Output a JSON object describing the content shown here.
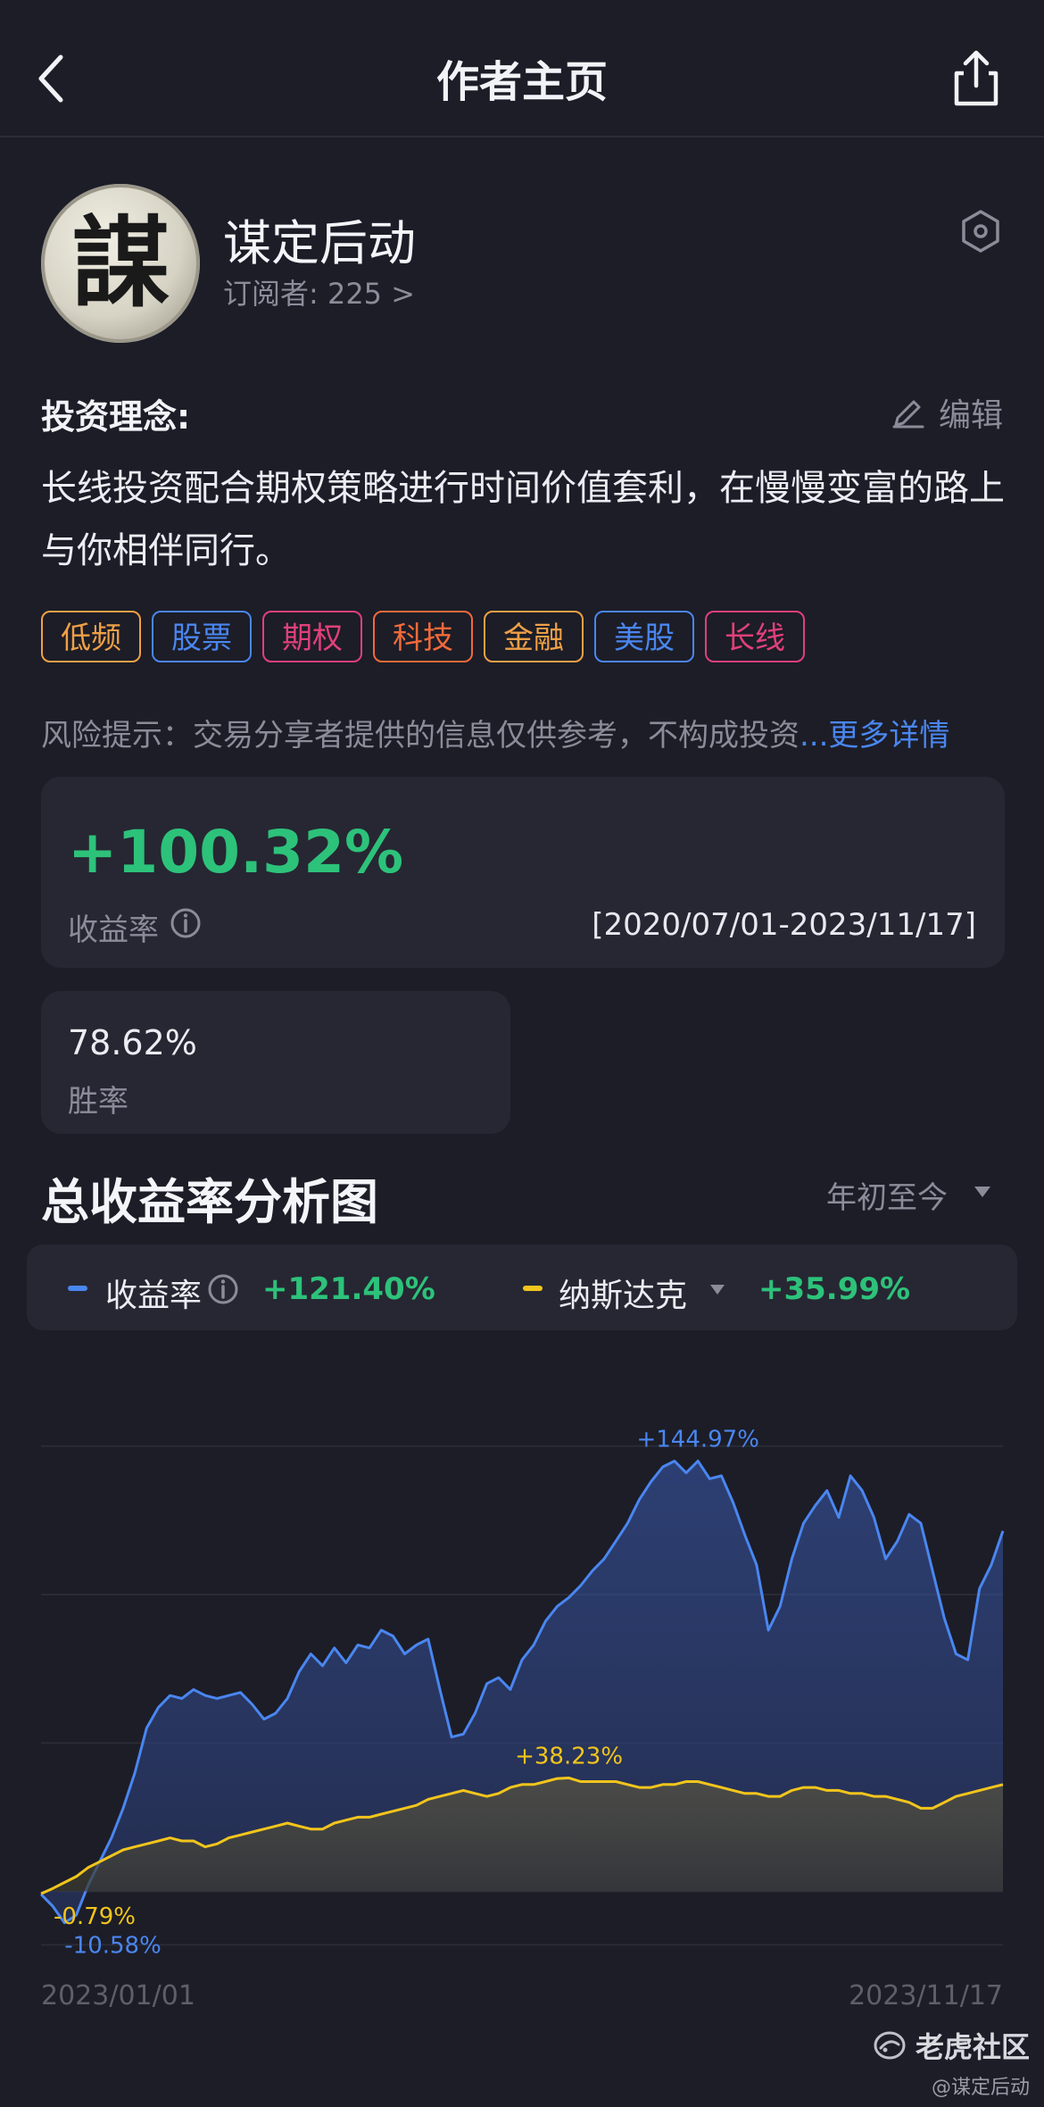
{
  "header": {
    "title": "作者主页"
  },
  "profile": {
    "avatar_char": "謀",
    "name": "谋定后动",
    "subscribers": "订阅者: 225 >",
    "philosophy_title": "投资理念:",
    "edit_label": "编辑",
    "philosophy_text": "长线投资配合期权策略进行时间价值套利，在慢慢变富的路上与你相伴同行。",
    "tags": [
      {
        "label": "低频",
        "color": "#f0a046"
      },
      {
        "label": "股票",
        "color": "#4a86f0"
      },
      {
        "label": "期权",
        "color": "#e0407a"
      },
      {
        "label": "科技",
        "color": "#f06a3a"
      },
      {
        "label": "金融",
        "color": "#f0a046"
      },
      {
        "label": "美股",
        "color": "#4a86f0"
      },
      {
        "label": "长线",
        "color": "#e0407a"
      }
    ],
    "risk_text": "风险提示：交易分享者提供的信息仅供参考，不构成投资",
    "risk_more": "...更多详情"
  },
  "stats": {
    "return_value": "+100.32%",
    "return_label": "收益率",
    "date_range": "[2020/07/01-2023/11/17]",
    "winrate_value": "78.62%",
    "winrate_label": "胜率"
  },
  "chart_section": {
    "title": "总收益率分析图",
    "range": "年初至今",
    "legend_a_name": "收益率",
    "legend_a_value": "+121.40%",
    "legend_b_name": "纳斯达克",
    "legend_b_value": "+35.99%",
    "x_start": "2023/01/01",
    "x_end": "2023/11/17"
  },
  "chart_data": {
    "type": "area",
    "x": [
      "2023/01/01",
      "2023/11/17"
    ],
    "xlabel": "",
    "ylabel": "",
    "ylim": [
      -20,
      180
    ],
    "grid": true,
    "series": [
      {
        "name": "收益率",
        "color": "#4a86f0",
        "values": [
          -1,
          -5,
          -10.58,
          -8,
          2,
          10,
          18,
          28,
          40,
          55,
          62,
          66,
          65,
          68,
          66,
          65,
          66,
          67,
          63,
          58,
          60,
          65,
          74,
          80,
          76,
          82,
          77,
          83,
          82,
          88,
          86,
          80,
          83,
          85,
          68,
          52,
          53,
          60,
          70,
          72,
          68,
          78,
          83,
          91,
          96,
          99,
          103,
          108,
          112,
          118,
          124,
          132,
          138,
          143,
          144.97,
          141,
          145,
          139,
          140,
          131,
          120,
          110,
          88,
          96,
          112,
          124,
          130,
          135,
          126,
          140,
          135,
          126,
          112,
          118,
          127,
          124,
          108,
          92,
          80,
          78,
          102,
          110,
          121.4
        ],
        "labels": [
          {
            "text": "+144.97%"
          },
          {
            "text": "-10.58%"
          }
        ]
      },
      {
        "name": "纳斯达克",
        "color": "#f2c51c",
        "values": [
          -0.79,
          1,
          3,
          5,
          8,
          10,
          12,
          14,
          15,
          16,
          17,
          18,
          17,
          17,
          15,
          16,
          18,
          19,
          20,
          21,
          22,
          23,
          22,
          21,
          21,
          23,
          24,
          25,
          25,
          26,
          27,
          28,
          29,
          31,
          32,
          33,
          34,
          33,
          32,
          33,
          35,
          36,
          36,
          37,
          38,
          38.23,
          37,
          37,
          37,
          37,
          36,
          35,
          35,
          36,
          36,
          37,
          37,
          36,
          35,
          34,
          33,
          33,
          32,
          32,
          34,
          35,
          35,
          34,
          34,
          33,
          33,
          32,
          32,
          31,
          30,
          28,
          28,
          30,
          32,
          33,
          34,
          35,
          35.99
        ],
        "labels": [
          {
            "text": "+38.23%"
          },
          {
            "text": "-0.79%"
          }
        ]
      }
    ]
  },
  "watermark": {
    "brand": "老虎社区",
    "user": "@谋定后动"
  }
}
